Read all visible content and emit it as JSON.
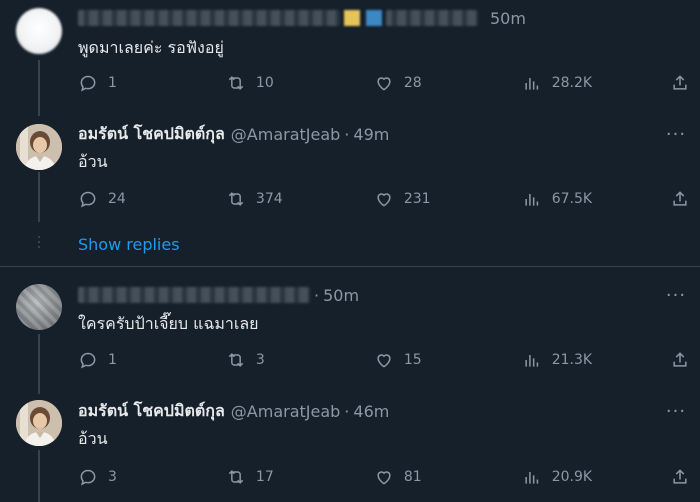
{
  "tweets": [
    {
      "name": "",
      "handle": "",
      "time": "50m",
      "text": "พูดมาเลยค่ะ รอฟังอยู่",
      "replies": "1",
      "retweets": "10",
      "likes": "28",
      "views": "28.2K"
    },
    {
      "name": "อมรัตน์ โชคปมิตต์กุล",
      "handle": "@AmaratJeab",
      "time": "49m",
      "text": "อ้วน",
      "replies": "24",
      "retweets": "374",
      "likes": "231",
      "views": "67.5K"
    },
    {
      "name": "",
      "handle": "",
      "time": "50m",
      "text": "ใครครับป้าเจี๊ยบ แฉมาเลย",
      "replies": "1",
      "retweets": "3",
      "likes": "15",
      "views": "21.3K"
    },
    {
      "name": "อมรัตน์ โชคปมิตต์กุล",
      "handle": "@AmaratJeab",
      "time": "46m",
      "text": "อ้วน",
      "replies": "3",
      "retweets": "17",
      "likes": "81",
      "views": "20.9K"
    }
  ],
  "show_replies_label": "Show replies",
  "separator": "·",
  "more_glyph": "···",
  "icons": {
    "reply": "reply-icon",
    "retweet": "retweet-icon",
    "like": "heart-icon",
    "views": "views-icon",
    "share": "share-icon",
    "more": "more-icon"
  },
  "colors": {
    "background": "#15202b",
    "text": "#e7e9ea",
    "secondary": "#8b98a5",
    "link": "#1d9bf0",
    "line": "#38444d"
  }
}
